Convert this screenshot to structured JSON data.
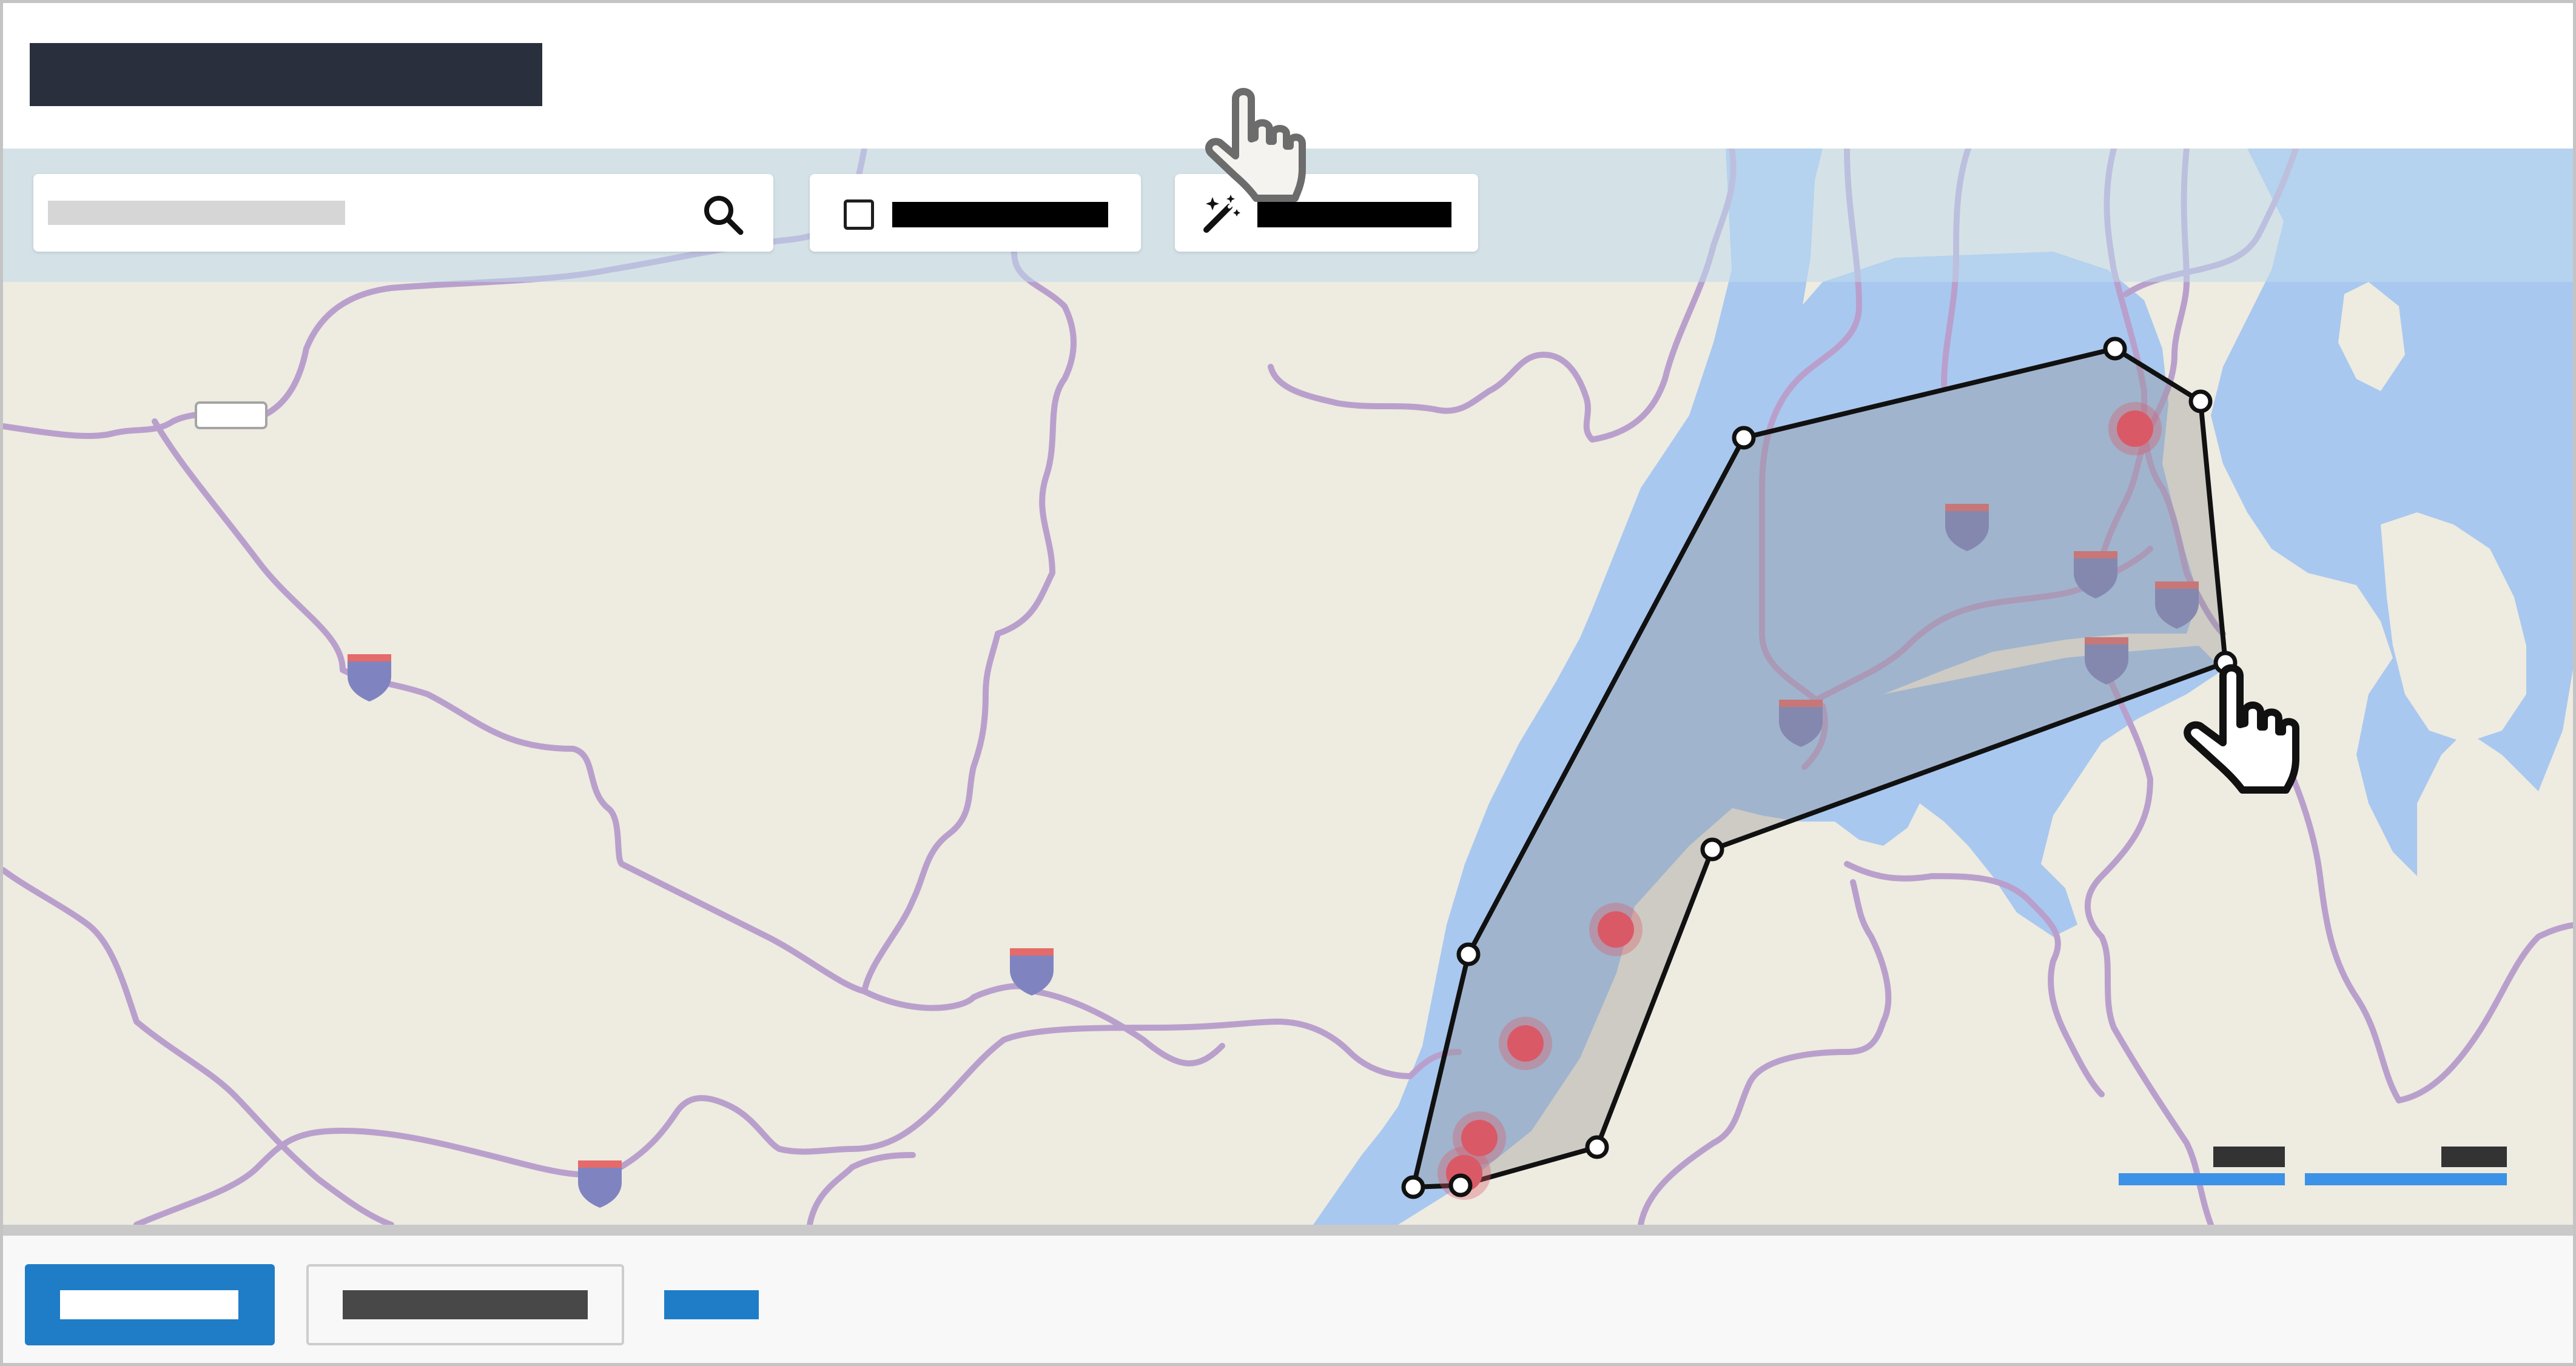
{
  "header": {
    "title": ""
  },
  "toolbar": {
    "search_placeholder": "",
    "search_value": "",
    "select_label": "",
    "auto_label": ""
  },
  "map": {
    "city_label": "",
    "scale_left_label": "",
    "scale_right_label": "",
    "colors": {
      "land": "#eeebe1",
      "water": "#a9c8ef",
      "road": "#b9a0cc",
      "selection": "#8f8f8f",
      "incident": "#d95a66",
      "shield": "#7f84c0"
    },
    "icons": [
      "search-icon",
      "magic-wand-icon",
      "hand-pointer-icon",
      "highway-shield-icon",
      "incident-marker-icon",
      "polygon-vertex-handle"
    ]
  },
  "footer": {
    "primary_label": "",
    "secondary_label": "",
    "link_label": ""
  }
}
